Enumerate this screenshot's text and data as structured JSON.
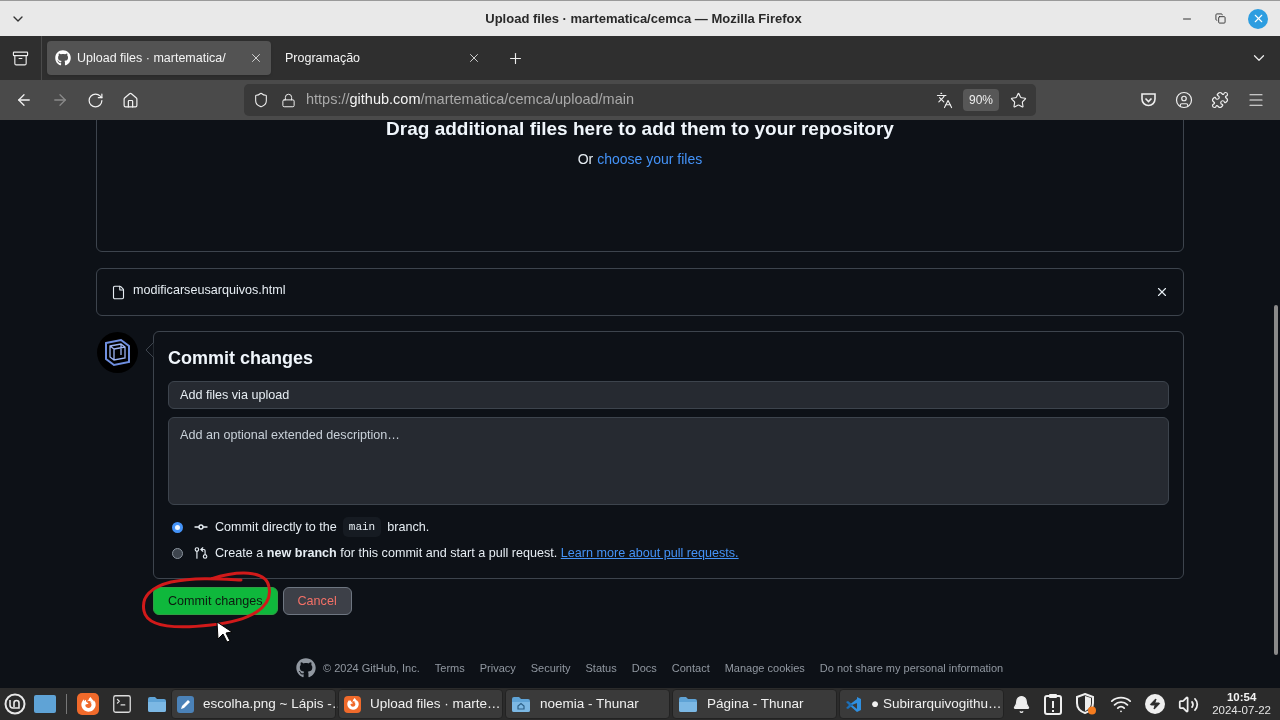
{
  "window": {
    "title": "Upload files · martematica/cemca — Mozilla Firefox"
  },
  "browser": {
    "tabs": [
      {
        "title": "Upload files · martematica/",
        "kind": "github",
        "selected": true
      },
      {
        "title": "Programação",
        "kind": "plain",
        "selected": false
      }
    ],
    "url": {
      "scheme": "https://",
      "host": "github.com",
      "path": "/martematica/cemca/upload/main"
    },
    "zoom": "90%"
  },
  "page": {
    "dropzone": {
      "heading": "Drag additional files here to add them to your repository",
      "prefix": "Or",
      "link": "choose your files"
    },
    "files": [
      {
        "name": "modificarseusarquivos.html"
      }
    ],
    "commit": {
      "title": "Commit changes",
      "summary": {
        "value": "Add files via upload"
      },
      "description": {
        "placeholder": "Add an optional extended description…"
      },
      "options": [
        {
          "kind": "direct",
          "selected": true,
          "text": "Commit directly to the",
          "branch": "main",
          "suffix": "branch."
        },
        {
          "kind": "new_branch",
          "selected": false,
          "text": "Create a **new branch** for this commit and start a pull request.",
          "link": "Learn more about pull requests."
        }
      ],
      "buttons": [
        {
          "kind": "primary",
          "label": "Commit changes"
        },
        {
          "kind": "cancel",
          "label": "Cancel"
        }
      ]
    },
    "footer": {
      "copyright": "© 2024 GitHub, Inc.",
      "links": [
        "Terms",
        "Privacy",
        "Security",
        "Status",
        "Docs",
        "Contact",
        "Manage cookies",
        "Do not share my personal information"
      ]
    }
  },
  "taskbar": {
    "windows": [
      {
        "title": "escolha.png ~ Lápis -…",
        "kind": "image_editor"
      },
      {
        "title": "Upload files · marte…",
        "kind": "browser"
      },
      {
        "title": "noemia - Thunar",
        "kind": "home_folder"
      },
      {
        "title": "Página - Thunar",
        "kind": "folder"
      },
      {
        "title": "● Subirarquivogithu…",
        "kind": "code_editor"
      }
    ],
    "clock": {
      "time": "10:54",
      "date": "2024-07-22"
    }
  }
}
